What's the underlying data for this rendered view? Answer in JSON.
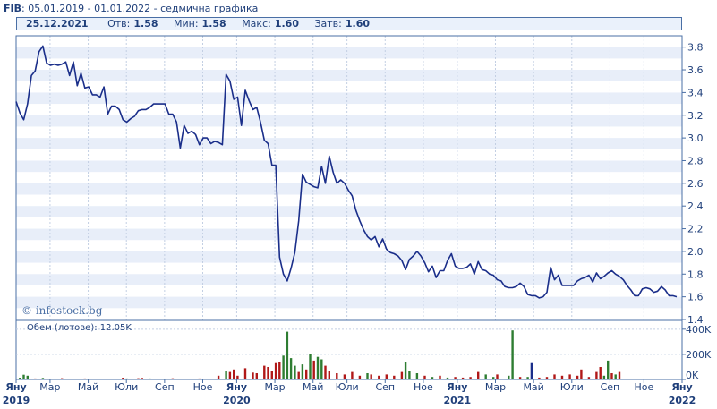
{
  "header": {
    "ticker": "FIB",
    "range": "05.01.2019 - 01.01.2022",
    "mode": "седмична графика"
  },
  "info_bar": {
    "date": "25.12.2021",
    "open_label": "Отв:",
    "open": "1.58",
    "min_label": "Мин:",
    "min": "1.58",
    "max_label": "Макс:",
    "max": "1.60",
    "close_label": "Затв:",
    "close": "1.60"
  },
  "watermark": "© infostock.bg",
  "volume_label": "Обем (лотове): 12.05K",
  "colors": {
    "line": "#1a2e8a",
    "band": "#e8eef9",
    "vol_up": "#2e7d32",
    "vol_down": "#b01818",
    "vol_flat": "#1a2e8a",
    "frame": "#4a6fa5",
    "text": "#1f3f7a"
  },
  "chart_data": {
    "type": "line",
    "price_axis": {
      "ylim": [
        1.4,
        3.9
      ],
      "ticks": [
        "3.8",
        "3.6",
        "3.4",
        "3.2",
        "3.0",
        "2.8",
        "2.6",
        "2.4",
        "2.2",
        "2.0",
        "1.8",
        "1.6",
        "1.4"
      ]
    },
    "volume_axis": {
      "ylim": [
        0,
        470
      ],
      "ticks": [
        "400K",
        "200K",
        "0K"
      ],
      "unit": "K"
    },
    "x_ticks": [
      {
        "week": 0,
        "label": "Яну",
        "year": "2019"
      },
      {
        "week": 8,
        "label": "Мар"
      },
      {
        "week": 17,
        "label": "Май"
      },
      {
        "week": 26,
        "label": "Юли"
      },
      {
        "week": 35,
        "label": "Сеп"
      },
      {
        "week": 44,
        "label": "Ное"
      },
      {
        "week": 52,
        "label": "Яну",
        "year": "2020"
      },
      {
        "week": 61,
        "label": "Мар"
      },
      {
        "week": 70,
        "label": "Май"
      },
      {
        "week": 78,
        "label": "Юли"
      },
      {
        "week": 87,
        "label": "Сеп"
      },
      {
        "week": 96,
        "label": "Ное"
      },
      {
        "week": 104,
        "label": "Яну",
        "year": "2021"
      },
      {
        "week": 113,
        "label": "Мар"
      },
      {
        "week": 122,
        "label": "Май"
      },
      {
        "week": 131,
        "label": "Юли"
      },
      {
        "week": 140,
        "label": "Сеп"
      },
      {
        "week": 148,
        "label": "Ное"
      },
      {
        "week": 157,
        "label": "Яну",
        "year": "2022"
      }
    ],
    "series": [
      {
        "values": [
          3.32,
          3.22,
          3.16,
          3.3,
          3.55,
          3.59,
          3.76,
          3.81,
          3.66,
          3.64,
          3.65,
          3.64,
          3.65,
          3.67,
          3.55,
          3.67,
          3.46,
          3.57,
          3.44,
          3.45,
          3.38,
          3.38,
          3.36,
          3.45,
          3.21,
          3.28,
          3.28,
          3.25,
          3.16,
          3.14,
          3.17,
          3.19,
          3.24,
          3.25,
          3.25,
          3.27,
          3.3,
          3.3,
          3.3,
          3.3,
          3.21,
          3.21,
          3.14,
          2.91,
          3.11,
          3.04,
          3.06,
          3.03,
          2.94,
          3.0,
          3.0,
          2.95,
          2.97,
          2.96,
          2.94,
          3.56,
          3.5,
          3.34,
          3.36,
          3.11,
          3.42,
          3.33,
          3.25,
          3.27,
          3.14,
          2.98,
          2.95,
          2.76,
          2.76,
          1.95,
          1.8,
          1.74,
          1.85,
          1.99,
          2.27,
          2.68,
          2.61,
          2.59,
          2.57,
          2.56,
          2.75,
          2.6,
          2.84,
          2.7,
          2.6,
          2.63,
          2.6,
          2.54,
          2.49,
          2.36,
          2.27,
          2.19,
          2.13,
          2.1,
          2.13,
          2.04,
          2.11,
          2.02,
          1.99,
          1.98,
          1.96,
          1.92,
          1.84,
          1.93,
          1.96,
          2.0,
          1.96,
          1.9,
          1.82,
          1.87,
          1.77,
          1.83,
          1.83,
          1.92,
          1.98,
          1.87,
          1.85,
          1.85,
          1.86,
          1.89,
          1.8,
          1.91,
          1.84,
          1.83,
          1.8,
          1.79,
          1.75,
          1.74,
          1.69,
          1.68,
          1.68,
          1.69,
          1.72,
          1.69,
          1.62,
          1.61,
          1.61,
          1.59,
          1.6,
          1.64,
          1.86,
          1.75,
          1.79,
          1.7,
          1.7,
          1.7,
          1.7,
          1.74,
          1.76,
          1.77,
          1.79,
          1.73,
          1.81,
          1.76,
          1.78,
          1.81,
          1.83,
          1.8,
          1.78,
          1.75,
          1.7,
          1.66,
          1.61,
          1.61,
          1.67,
          1.68,
          1.67,
          1.64,
          1.65,
          1.69,
          1.66,
          1.61,
          1.61,
          1.6
        ]
      }
    ],
    "volume": [
      {
        "week": 1,
        "value": 14,
        "dir": "up"
      },
      {
        "week": 2,
        "value": 38,
        "dir": "up"
      },
      {
        "week": 3,
        "value": 30,
        "dir": "up"
      },
      {
        "week": 5,
        "value": 8,
        "dir": "down"
      },
      {
        "week": 7,
        "value": 12,
        "dir": "up"
      },
      {
        "week": 9,
        "value": 6,
        "dir": "down"
      },
      {
        "week": 12,
        "value": 10,
        "dir": "down"
      },
      {
        "week": 15,
        "value": 6,
        "dir": "up"
      },
      {
        "week": 18,
        "value": 8,
        "dir": "down"
      },
      {
        "week": 20,
        "value": 5,
        "dir": "down"
      },
      {
        "week": 23,
        "value": 7,
        "dir": "down"
      },
      {
        "week": 25,
        "value": 6,
        "dir": "up"
      },
      {
        "week": 28,
        "value": 14,
        "dir": "down"
      },
      {
        "week": 29,
        "value": 8,
        "dir": "up"
      },
      {
        "week": 32,
        "value": 10,
        "dir": "down"
      },
      {
        "week": 33,
        "value": 12,
        "dir": "down"
      },
      {
        "week": 35,
        "value": 8,
        "dir": "up"
      },
      {
        "week": 38,
        "value": 6,
        "dir": "down"
      },
      {
        "week": 41,
        "value": 9,
        "dir": "down"
      },
      {
        "week": 43,
        "value": 7,
        "dir": "down"
      },
      {
        "week": 46,
        "value": 6,
        "dir": "up"
      },
      {
        "week": 48,
        "value": 8,
        "dir": "down"
      },
      {
        "week": 50,
        "value": 5,
        "dir": "down"
      },
      {
        "week": 53,
        "value": 30,
        "dir": "down"
      },
      {
        "week": 55,
        "value": 70,
        "dir": "up"
      },
      {
        "week": 56,
        "value": 60,
        "dir": "down"
      },
      {
        "week": 57,
        "value": 80,
        "dir": "down"
      },
      {
        "week": 58,
        "value": 30,
        "dir": "down"
      },
      {
        "week": 60,
        "value": 90,
        "dir": "down"
      },
      {
        "week": 62,
        "value": 55,
        "dir": "down"
      },
      {
        "week": 63,
        "value": 50,
        "dir": "down"
      },
      {
        "week": 65,
        "value": 110,
        "dir": "down"
      },
      {
        "week": 66,
        "value": 100,
        "dir": "down"
      },
      {
        "week": 67,
        "value": 70,
        "dir": "down"
      },
      {
        "week": 68,
        "value": 130,
        "dir": "down"
      },
      {
        "week": 69,
        "value": 140,
        "dir": "down"
      },
      {
        "week": 70,
        "value": 190,
        "dir": "up"
      },
      {
        "week": 71,
        "value": 380,
        "dir": "up"
      },
      {
        "week": 72,
        "value": 170,
        "dir": "up"
      },
      {
        "week": 73,
        "value": 110,
        "dir": "up"
      },
      {
        "week": 74,
        "value": 60,
        "dir": "down"
      },
      {
        "week": 75,
        "value": 120,
        "dir": "up"
      },
      {
        "week": 76,
        "value": 80,
        "dir": "down"
      },
      {
        "week": 77,
        "value": 200,
        "dir": "up"
      },
      {
        "week": 78,
        "value": 150,
        "dir": "down"
      },
      {
        "week": 79,
        "value": 180,
        "dir": "up"
      },
      {
        "week": 80,
        "value": 160,
        "dir": "up"
      },
      {
        "week": 81,
        "value": 110,
        "dir": "down"
      },
      {
        "week": 82,
        "value": 70,
        "dir": "down"
      },
      {
        "week": 84,
        "value": 50,
        "dir": "down"
      },
      {
        "week": 86,
        "value": 40,
        "dir": "down"
      },
      {
        "week": 88,
        "value": 60,
        "dir": "down"
      },
      {
        "week": 90,
        "value": 30,
        "dir": "down"
      },
      {
        "week": 92,
        "value": 50,
        "dir": "up"
      },
      {
        "week": 93,
        "value": 40,
        "dir": "down"
      },
      {
        "week": 95,
        "value": 30,
        "dir": "down"
      },
      {
        "week": 97,
        "value": 40,
        "dir": "down"
      },
      {
        "week": 99,
        "value": 30,
        "dir": "down"
      },
      {
        "week": 101,
        "value": 60,
        "dir": "down"
      },
      {
        "week": 102,
        "value": 140,
        "dir": "up"
      },
      {
        "week": 103,
        "value": 70,
        "dir": "up"
      },
      {
        "week": 105,
        "value": 50,
        "dir": "up"
      },
      {
        "week": 107,
        "value": 30,
        "dir": "down"
      },
      {
        "week": 109,
        "value": 20,
        "dir": "up"
      },
      {
        "week": 111,
        "value": 30,
        "dir": "down"
      },
      {
        "week": 113,
        "value": 15,
        "dir": "up"
      },
      {
        "week": 115,
        "value": 20,
        "dir": "down"
      },
      {
        "week": 117,
        "value": 15,
        "dir": "down"
      },
      {
        "week": 119,
        "value": 20,
        "dir": "down"
      },
      {
        "week": 121,
        "value": 60,
        "dir": "down"
      },
      {
        "week": 123,
        "value": 40,
        "dir": "up"
      },
      {
        "week": 125,
        "value": 20,
        "dir": "up"
      },
      {
        "week": 126,
        "value": 40,
        "dir": "down"
      },
      {
        "week": 129,
        "value": 30,
        "dir": "up"
      },
      {
        "week": 130,
        "value": 390,
        "dir": "up"
      },
      {
        "week": 132,
        "value": 20,
        "dir": "down"
      },
      {
        "week": 134,
        "value": 20,
        "dir": "up"
      },
      {
        "week": 135,
        "value": 130,
        "dir": "flat"
      },
      {
        "week": 137,
        "value": 15,
        "dir": "down"
      },
      {
        "week": 139,
        "value": 20,
        "dir": "down"
      },
      {
        "week": 141,
        "value": 40,
        "dir": "down"
      },
      {
        "week": 143,
        "value": 30,
        "dir": "down"
      },
      {
        "week": 145,
        "value": 40,
        "dir": "down"
      },
      {
        "week": 147,
        "value": 30,
        "dir": "down"
      },
      {
        "week": 148,
        "value": 80,
        "dir": "down"
      },
      {
        "week": 150,
        "value": 20,
        "dir": "down"
      },
      {
        "week": 152,
        "value": 60,
        "dir": "down"
      },
      {
        "week": 153,
        "value": 100,
        "dir": "down"
      },
      {
        "week": 154,
        "value": 30,
        "dir": "up"
      },
      {
        "week": 155,
        "value": 150,
        "dir": "up"
      },
      {
        "week": 156,
        "value": 50,
        "dir": "down"
      },
      {
        "week": 157,
        "value": 40,
        "dir": "up"
      },
      {
        "week": 158,
        "value": 60,
        "dir": "down"
      }
    ]
  }
}
